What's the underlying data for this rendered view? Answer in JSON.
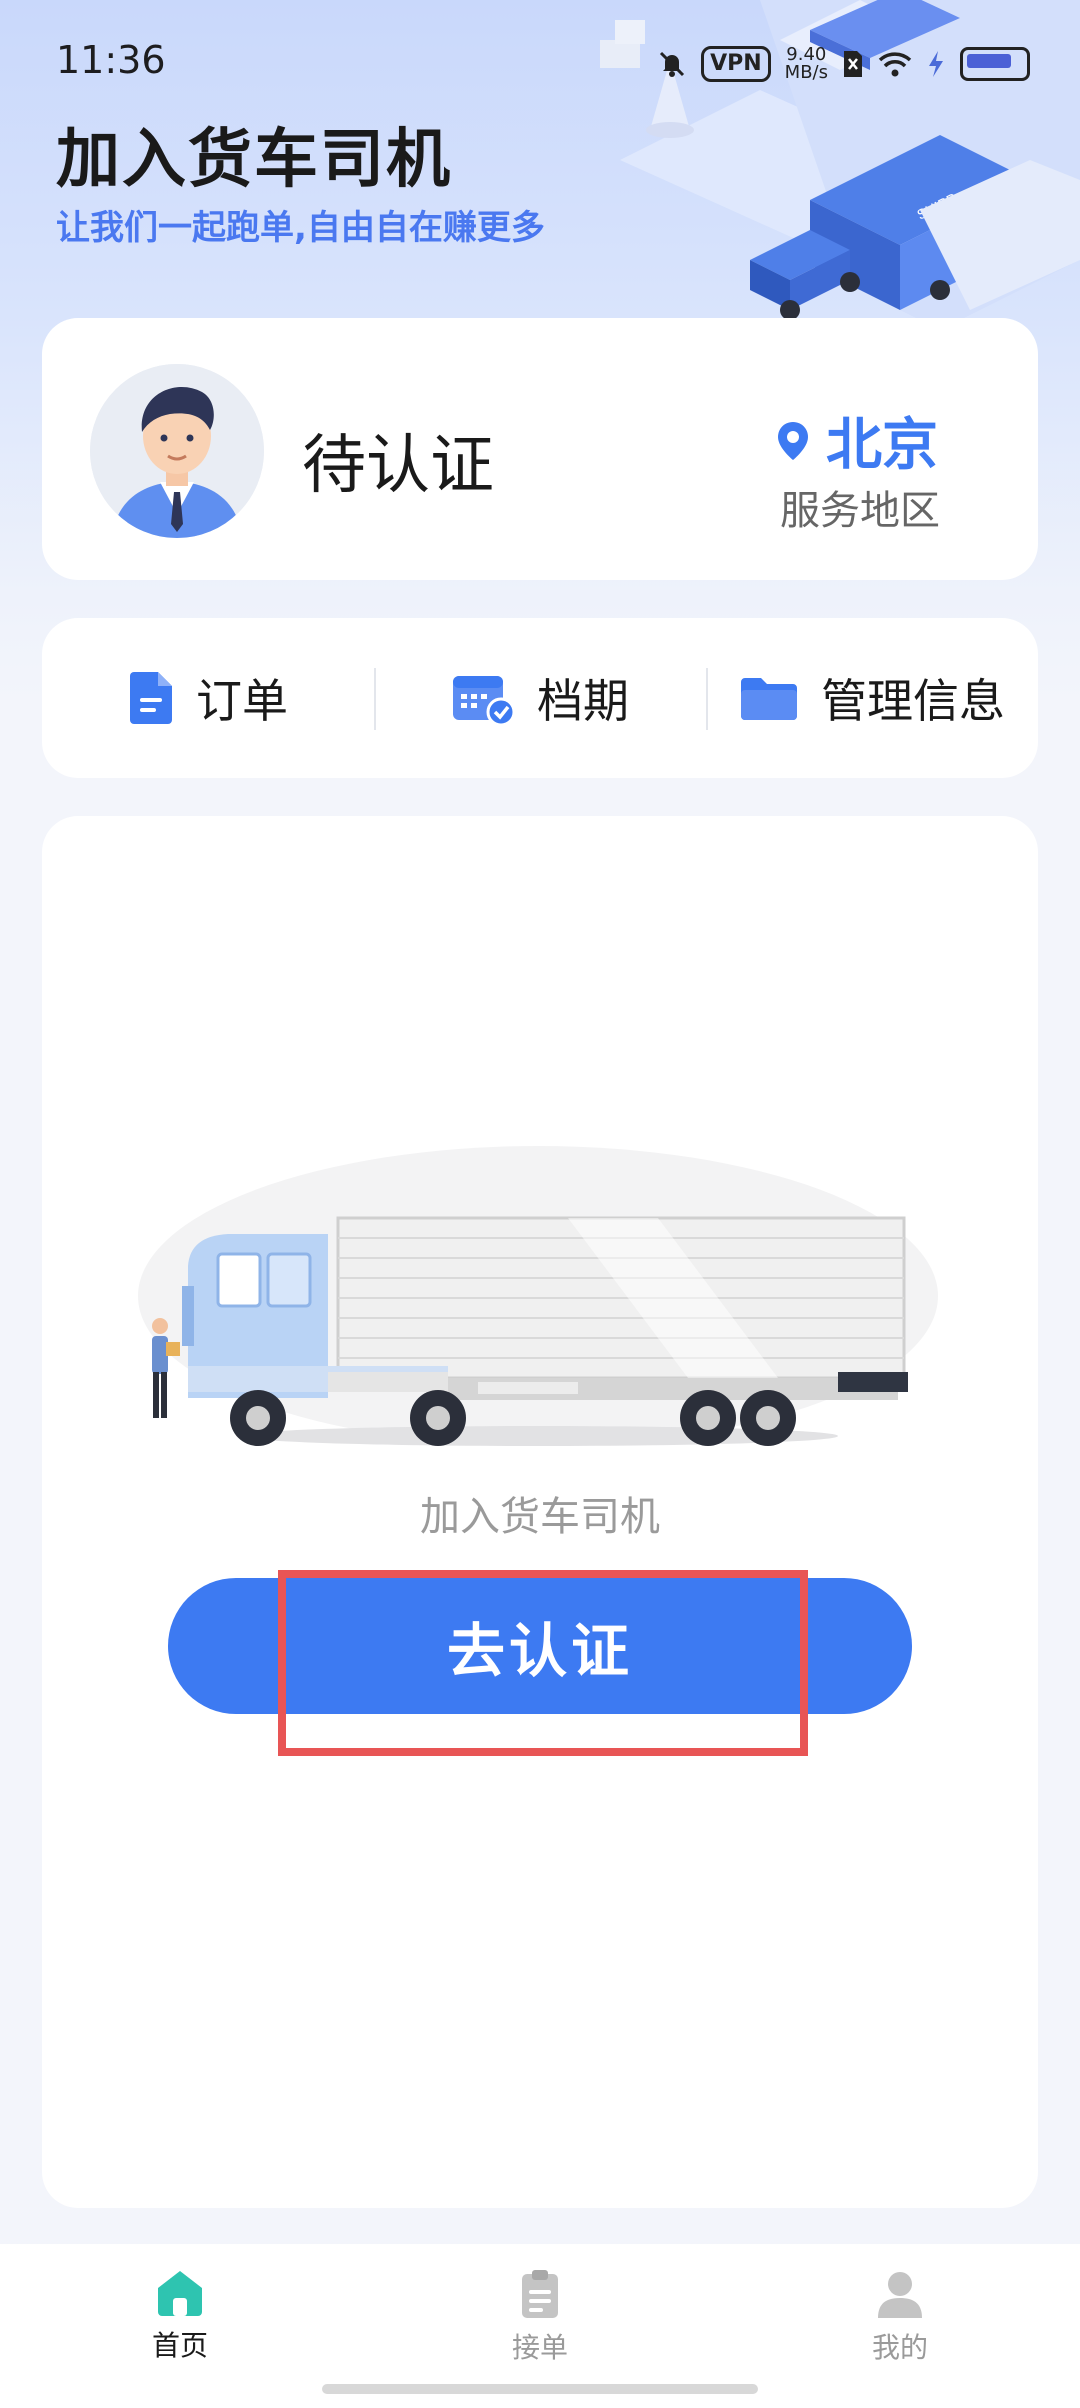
{
  "status_bar": {
    "time": "11:36",
    "vpn": "VPN",
    "speed_value": "9.40",
    "speed_unit": "MB/s"
  },
  "header": {
    "title": "加入货车司机",
    "subtitle": "让我们一起跑单,自由自在赚更多"
  },
  "profile": {
    "status": "待认证",
    "city": "北京",
    "area_label": "服务地区"
  },
  "menu": [
    {
      "label": "订单",
      "icon": "document-icon"
    },
    {
      "label": "档期",
      "icon": "calendar-check-icon"
    },
    {
      "label": "管理信息",
      "icon": "folder-icon"
    }
  ],
  "main": {
    "empty_text": "加入货车司机",
    "verify_button": "去认证"
  },
  "tabbar": {
    "items": [
      {
        "label": "首页",
        "icon": "home-icon",
        "active": true
      },
      {
        "label": "接单",
        "icon": "clipboard-icon",
        "active": false
      },
      {
        "label": "我的",
        "icon": "user-icon",
        "active": false
      }
    ]
  },
  "colors": {
    "accent": "#3d7af2",
    "subtitle": "#4a78f0",
    "tab_active": "#2ec4b0",
    "highlight": "#e85555"
  }
}
